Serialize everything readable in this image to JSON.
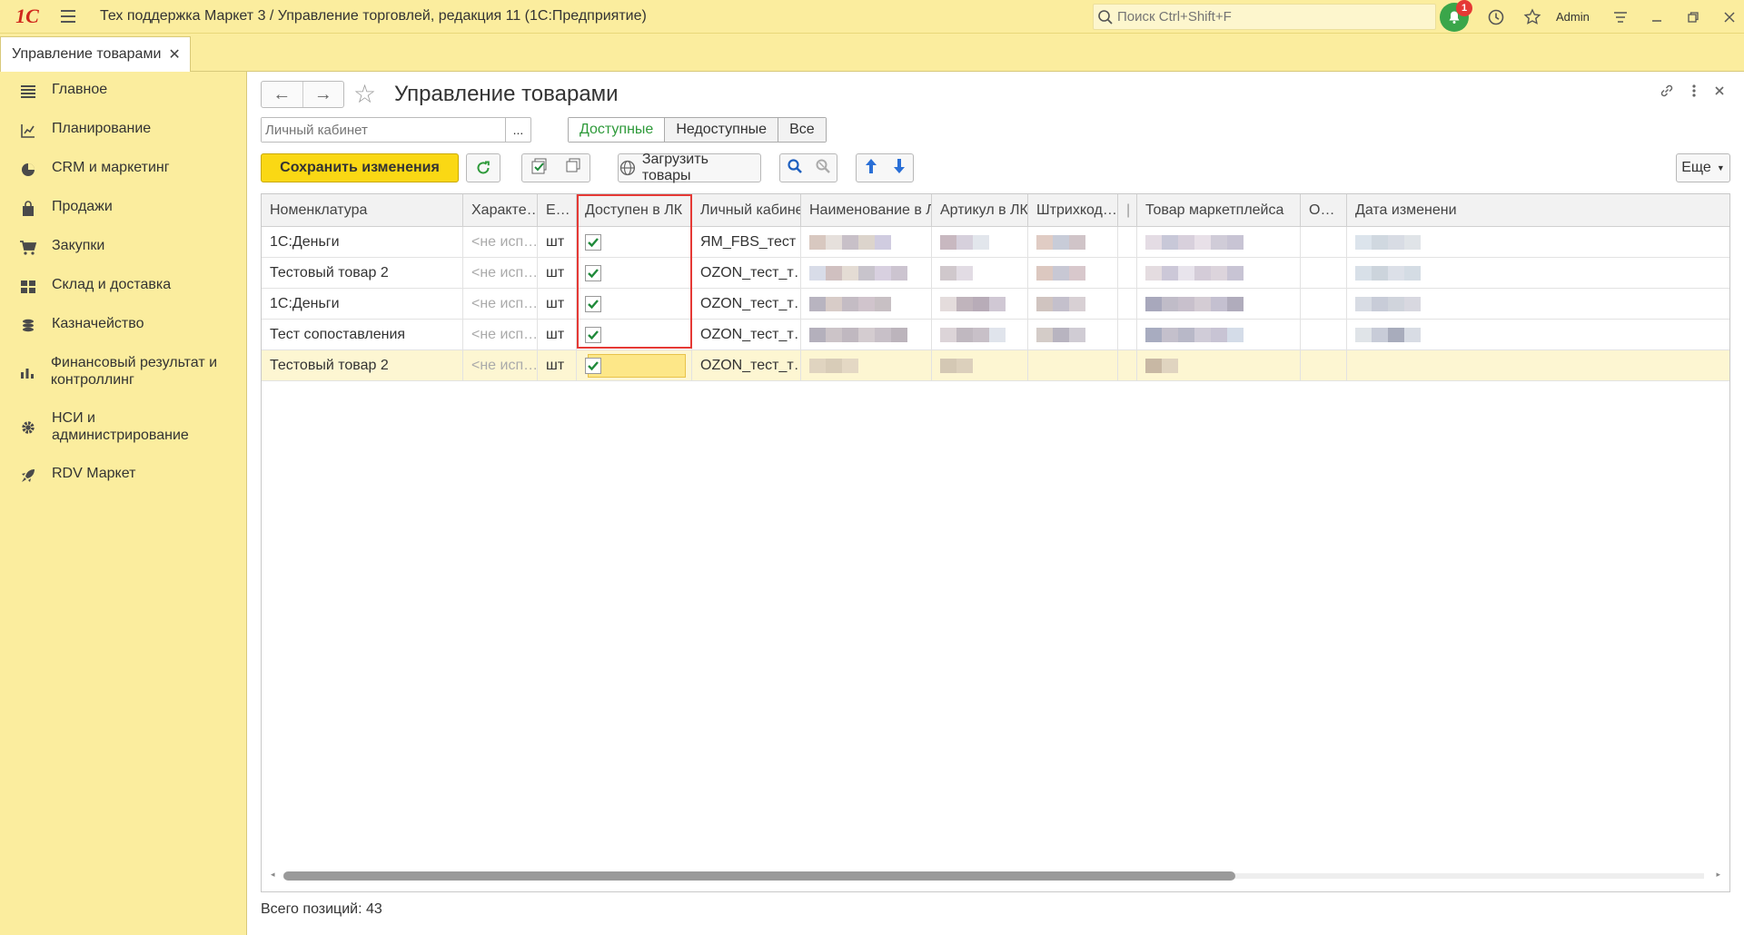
{
  "titlebar": {
    "logo": "1С",
    "title": "Тех поддержка Маркет 3 / Управление торговлей, редакция 11  (1С:Предприятие)",
    "search_placeholder": "Поиск Ctrl+Shift+F",
    "notifications_count": "1",
    "user": "Admin"
  },
  "tab": {
    "label": "Управление товарами",
    "close": "✕"
  },
  "sidebar": {
    "items": [
      {
        "label": "Главное",
        "icon": "menu-lines-icon"
      },
      {
        "label": "Планирование",
        "icon": "planning-icon"
      },
      {
        "label": "CRM и маркетинг",
        "icon": "pie-chart-icon"
      },
      {
        "label": "Продажи",
        "icon": "shopping-bag-icon"
      },
      {
        "label": "Закупки",
        "icon": "cart-icon"
      },
      {
        "label": "Склад и доставка",
        "icon": "warehouse-icon"
      },
      {
        "label": "Казначейство",
        "icon": "coins-icon"
      },
      {
        "label": "Финансовый результат и контроллинг",
        "icon": "bar-chart-icon"
      },
      {
        "label": "НСИ и администрирование",
        "icon": "gear-icon"
      },
      {
        "label": "RDV Маркет",
        "icon": "rocket-icon"
      }
    ]
  },
  "main": {
    "title": "Управление товарами",
    "lk_placeholder": "Личный кабинет",
    "lk_dots": "...",
    "filters": [
      "Доступные",
      "Недоступные",
      "Все"
    ],
    "toolbar": {
      "save": "Сохранить изменения",
      "load": "Загрузить товары",
      "more": "Еще"
    },
    "columns": [
      "Номенклатура",
      "Характе…",
      "Е…",
      "Доступен в ЛК",
      "Личный кабинет",
      "Наименование в ЛК",
      "Артикул в ЛК",
      "Штрихкод…",
      "|",
      "Товар маркетплейса",
      "О…",
      "Дата изменения"
    ],
    "rows": [
      {
        "name": "1С:Деньги",
        "char": "<не исп…",
        "unit": "шт",
        "available": true,
        "lk": "ЯМ_FBS_тест"
      },
      {
        "name": "Тестовый товар 2",
        "char": "<не исп…",
        "unit": "шт",
        "available": true,
        "lk": "OZON_тест_т…"
      },
      {
        "name": "1С:Деньги",
        "char": "<не исп…",
        "unit": "шт",
        "available": true,
        "lk": "OZON_тест_т…"
      },
      {
        "name": "Тест сопоставления",
        "char": "<не исп…",
        "unit": "шт",
        "available": true,
        "lk": "OZON_тест_т…"
      },
      {
        "name": "Тестовый товар 2",
        "char": "<не исп…",
        "unit": "шт",
        "available": true,
        "lk": "OZON_тест_т…"
      }
    ],
    "footer": "Всего позиций: 43"
  }
}
